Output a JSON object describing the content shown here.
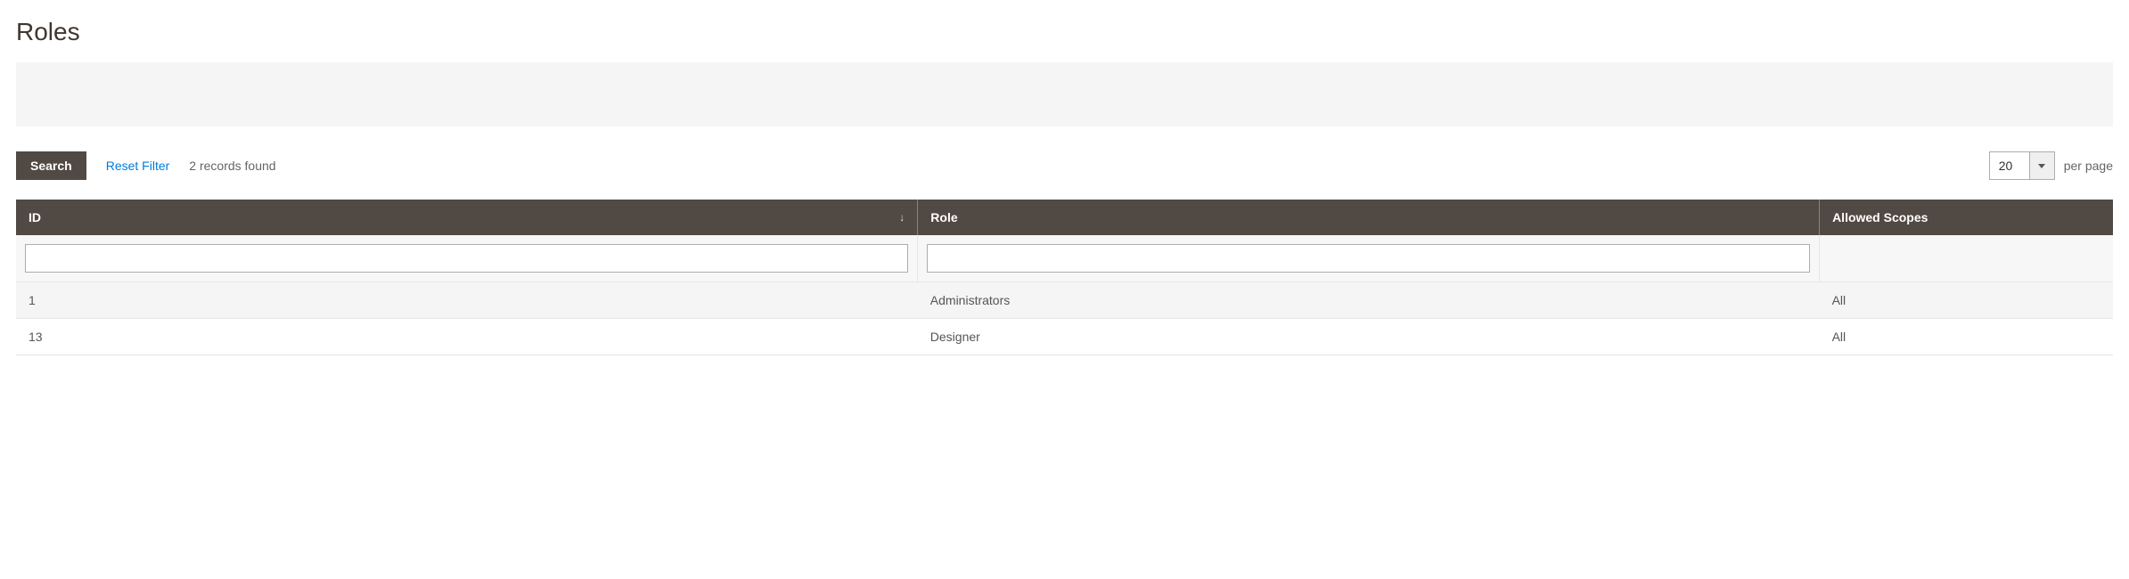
{
  "page": {
    "title": "Roles"
  },
  "toolbar": {
    "search_label": "Search",
    "reset_filter_label": "Reset Filter",
    "records_found": "2 records found",
    "page_size": "20",
    "per_page_label": "per page"
  },
  "table": {
    "columns": {
      "id": "ID",
      "role": "Role",
      "scopes": "Allowed Scopes"
    },
    "filters": {
      "id": "",
      "role": ""
    },
    "rows": [
      {
        "id": "1",
        "role": "Administrators",
        "scopes": "All"
      },
      {
        "id": "13",
        "role": "Designer",
        "scopes": "All"
      }
    ]
  }
}
